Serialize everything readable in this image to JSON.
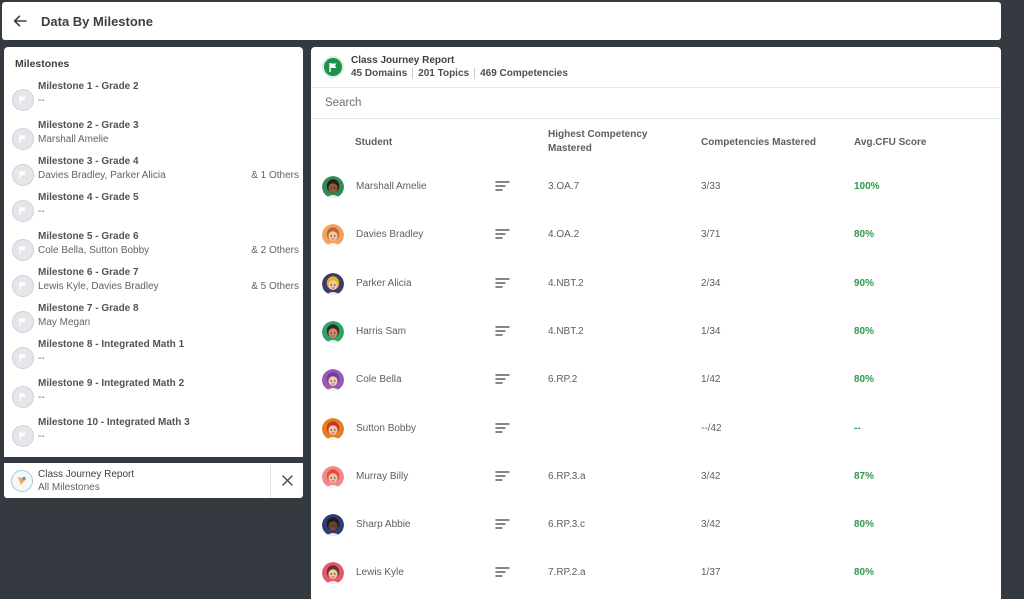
{
  "header": {
    "title": "Data By Milestone"
  },
  "left": {
    "title": "Milestones",
    "milestones": [
      {
        "title": "Milestone 1 - Grade 2",
        "students": "--",
        "others": ""
      },
      {
        "title": "Milestone 2 - Grade 3",
        "students": "Marshall Amelie",
        "others": ""
      },
      {
        "title": "Milestone 3 - Grade 4",
        "students": "Davies Bradley,  Parker Alicia",
        "others": "& 1 Others"
      },
      {
        "title": "Milestone 4 - Grade 5",
        "students": "--",
        "others": ""
      },
      {
        "title": "Milestone 5 - Grade 6",
        "students": "Cole Bella,  Sutton Bobby",
        "others": "& 2 Others"
      },
      {
        "title": "Milestone 6 - Grade 7",
        "students": "Lewis Kyle,  Davies Bradley",
        "others": "& 5 Others"
      },
      {
        "title": "Milestone 7 - Grade 8",
        "students": "May Megan",
        "others": ""
      },
      {
        "title": "Milestone 8 - Integrated Math 1",
        "students": "--",
        "others": ""
      },
      {
        "title": "Milestone 9 - Integrated Math 2",
        "students": "--",
        "others": ""
      },
      {
        "title": "Milestone 10 - Integrated Math 3",
        "students": "--",
        "others": ""
      }
    ],
    "footer": {
      "title": "Class Journey Report",
      "subtitle": "All Milestones"
    }
  },
  "report": {
    "title": "Class Journey Report",
    "domains": "45 Domains",
    "topics": "201 Topics",
    "competencies": "469 Competencies",
    "search_placeholder": "Search",
    "columns": {
      "student": "Student",
      "highest_line1": "Highest Competency",
      "highest_line2": "Mastered",
      "mastered": "Competencies Mastered",
      "score": "Avg.CFU Score"
    },
    "rows": [
      {
        "name": "Marshall Amelie",
        "highest": "3.OA.7",
        "mastered": "3/33",
        "score": "100%",
        "skin": "#8a5a3b",
        "hair": "#2a1c14",
        "bg": "#2e8b57"
      },
      {
        "name": "Davies Bradley",
        "highest": "4.OA.2",
        "mastered": "3/71",
        "score": "80%",
        "skin": "#f1c8a4",
        "hair": "#c2652b",
        "bg": "#f4a261"
      },
      {
        "name": "Parker Alicia",
        "highest": "4.NBT.2",
        "mastered": "2/34",
        "score": "90%",
        "skin": "#f0c9a6",
        "hair": "#e6b325",
        "bg": "#3d3a6e"
      },
      {
        "name": "Harris Sam",
        "highest": "4.NBT.2",
        "mastered": "1/34",
        "score": "80%",
        "skin": "#c98f6b",
        "hair": "#3b2a20",
        "bg": "#2fa36b"
      },
      {
        "name": "Cole Bella",
        "highest": "6.RP.2",
        "mastered": "1/42",
        "score": "80%",
        "skin": "#f2cdb0",
        "hair": "#6b3fa0",
        "bg": "#9b59b6"
      },
      {
        "name": "Sutton Bobby",
        "highest": "",
        "mastered": "--/42",
        "score": "--",
        "skin": "#f4c9a0",
        "hair": "#c0392b",
        "bg": "#e67e22"
      },
      {
        "name": "Murray Billy",
        "highest": "6.RP.3.a",
        "mastered": "3/42",
        "score": "87%",
        "skin": "#f3c5a8",
        "hair": "#e74c3c",
        "bg": "#f08a8a"
      },
      {
        "name": "Sharp Abbie",
        "highest": "6.RP.3.c",
        "mastered": "3/42",
        "score": "80%",
        "skin": "#6b4430",
        "hair": "#1e1a1a",
        "bg": "#2c3e70"
      },
      {
        "name": "Lewis Kyle",
        "highest": "7.RP.2.a",
        "mastered": "1/37",
        "score": "80%",
        "skin": "#f1c7a5",
        "hair": "#5a3825",
        "bg": "#e9556e"
      }
    ]
  },
  "icons": {
    "back": "arrow-left-icon",
    "milestone": "flag-icon",
    "sort": "sort-lines-icon",
    "close": "close-icon",
    "report": "flag-badge-icon"
  }
}
